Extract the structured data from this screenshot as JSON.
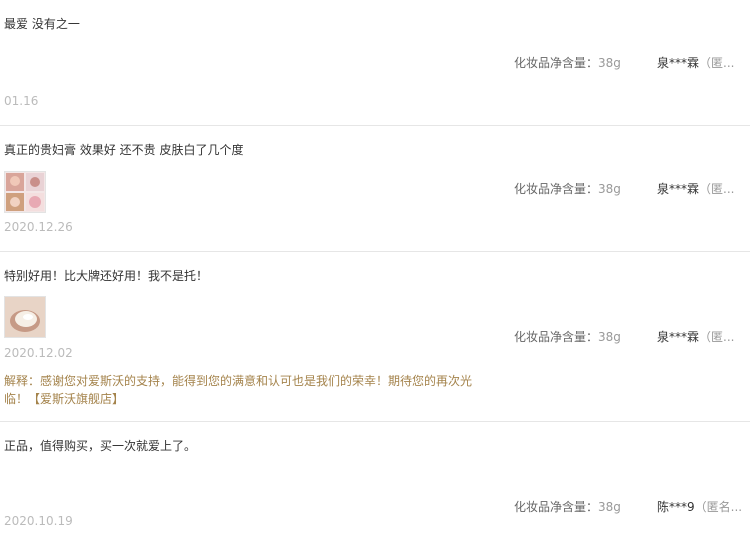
{
  "reviews": [
    {
      "content": "最爱 没有之一",
      "date": "01.16",
      "sku_label": "化妆品净含量：",
      "sku_value": "38g",
      "user": "泉***霖",
      "anon": "（匿..."
    },
    {
      "content": "真正的贵妇膏 效果好 还不贵 皮肤白了几个度",
      "date": "2020.12.26",
      "sku_label": "化妆品净含量：",
      "sku_value": "38g",
      "user": "泉***霖",
      "anon": "（匿..."
    },
    {
      "content": "特别好用！比大牌还好用！我不是托！",
      "date": "2020.12.02",
      "reply": "解释：感谢您对爱斯沃的支持，能得到您的满意和认可也是我们的荣幸！期待您的再次光临！【爱斯沃旗舰店】",
      "sku_label": "化妆品净含量：",
      "sku_value": "38g",
      "user": "泉***霖",
      "anon": "（匿..."
    },
    {
      "content": "正品，值得购买，买一次就爱上了。",
      "date": "2020.10.19",
      "sku_label": "化妆品净含量：",
      "sku_value": "38g",
      "user": "陈***9",
      "anon": "（匿名..."
    }
  ]
}
